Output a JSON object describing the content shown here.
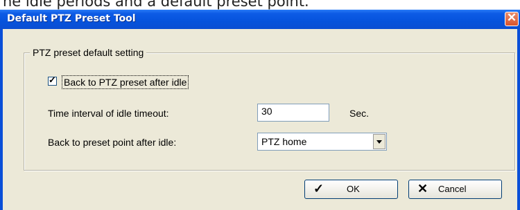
{
  "caption": "he idle periods and a default preset point.",
  "window": {
    "title": "Default PTZ Preset Tool",
    "close_glyph": "✕"
  },
  "group": {
    "legend": "PTZ preset default setting",
    "back_to_preset": {
      "label": "Back to PTZ preset after idle",
      "checked": true
    },
    "idle_timeout": {
      "label": "Time interval of idle timeout:",
      "value": "30",
      "unit": "Sec."
    },
    "preset_point": {
      "label": "Back to preset point after idle:",
      "selected": "PTZ home"
    }
  },
  "buttons": {
    "ok": {
      "label": "OK",
      "icon": "checkmark-icon"
    },
    "cancel": {
      "label": "Cancel",
      "icon": "x-icon"
    }
  },
  "colors": {
    "titlebar": "#0653dc",
    "dialog_bg": "#ece9d8",
    "close_button": "#d9532d"
  }
}
